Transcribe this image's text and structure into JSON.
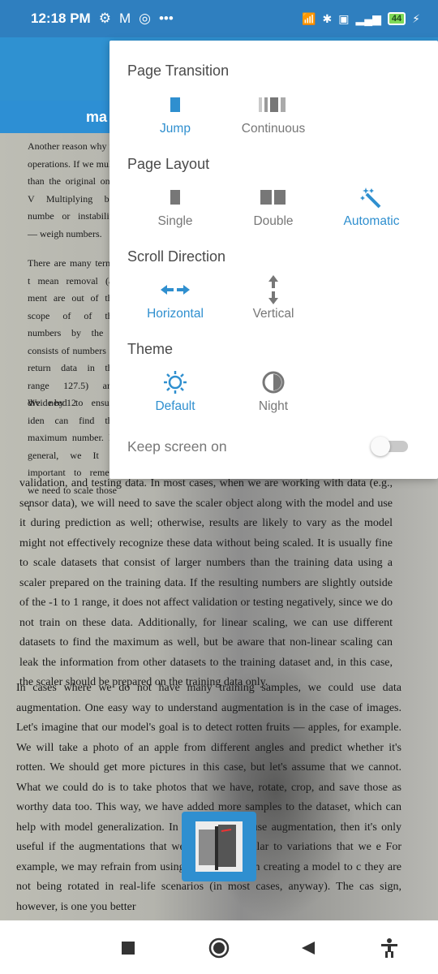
{
  "status": {
    "time": "12:18 PM",
    "battery": "44"
  },
  "title": {
    "visible_text": "ma"
  },
  "document": {
    "narrow_para_1": "Another reason why th operations. If we multi than the original one. V Multiplying big numbe or instability — weigh numbers.",
    "narrow_para_2": "There are many terms t mean removal (as ment are out of the scope of of the numbers by the r consists of numbers in return data in the range 127.5) and divide by 12",
    "narrow_para_3": "We need to ensure iden can find the maximum number. In general, we It is important to remem we need to scale those t",
    "lower_para": "validation, and testing data. In most cases, when we are working with data (e.g., sensor data), we will need to save the scaler object along with the model and use it during prediction as well; otherwise, results are likely to vary as the model might not effectively recognize these data without being scaled. It is usually fine to scale datasets that consist of larger numbers than the training data using a scaler prepared on the training data. If the resulting numbers are slightly outside of the -1 to 1 range, it does not affect validation or testing negatively, since we do not train on these data. Additionally, for linear scaling, we can use different datasets to find the maximum as well, but be aware that non-linear scaling can leak the information from other datasets to the training dataset and, in this case, the scaler should be prepared on the training data only.",
    "last_para": "In cases where we do not have many training samples, we could use data augmentation. One easy way to understand augmentation is in the case of images. Let's imagine that our model's goal is to detect rotten fruits — apples, for example. We will take a photo of an apple from different angles and predict whether it's rotten. We should get more pictures in this case, but let's assume that we cannot. What we could do is to take photos that we have, rotate, crop, and save those as worthy data too. This way, we have added more samples to the dataset, which can help with model generalization. In general, if we use augmentation, then it's only useful if the augmentations that we make are similar to variations that we e For example, we may refrain from using a rotation when creating a model to c they are not being rotated in real-life scenarios (in most cases, anyway). The cas sign, however, is one you better"
  },
  "menu": {
    "page_transition": {
      "title": "Page Transition",
      "options": [
        {
          "label": "Jump",
          "icon": "single-bar-icon",
          "selected": true
        },
        {
          "label": "Continuous",
          "icon": "continuous-bars-icon",
          "selected": false
        }
      ]
    },
    "page_layout": {
      "title": "Page Layout",
      "options": [
        {
          "label": "Single",
          "icon": "single-page-icon",
          "selected": false
        },
        {
          "label": "Double",
          "icon": "double-page-icon",
          "selected": false
        },
        {
          "label": "Automatic",
          "icon": "magic-wand-icon",
          "selected": true
        }
      ]
    },
    "scroll_direction": {
      "title": "Scroll Direction",
      "options": [
        {
          "label": "Horizontal",
          "icon": "horizontal-arrows-icon",
          "selected": true
        },
        {
          "label": "Vertical",
          "icon": "vertical-arrows-icon",
          "selected": false
        }
      ]
    },
    "theme": {
      "title": "Theme",
      "options": [
        {
          "label": "Default",
          "icon": "sun-icon",
          "selected": true
        },
        {
          "label": "Night",
          "icon": "half-moon-icon",
          "selected": false
        }
      ]
    },
    "keep_screen_on": {
      "label": "Keep screen on",
      "enabled": false
    }
  },
  "colors": {
    "accent": "#2f8fcf",
    "statusbar": "#2f7fbf",
    "appbar": "#2f91d1"
  }
}
